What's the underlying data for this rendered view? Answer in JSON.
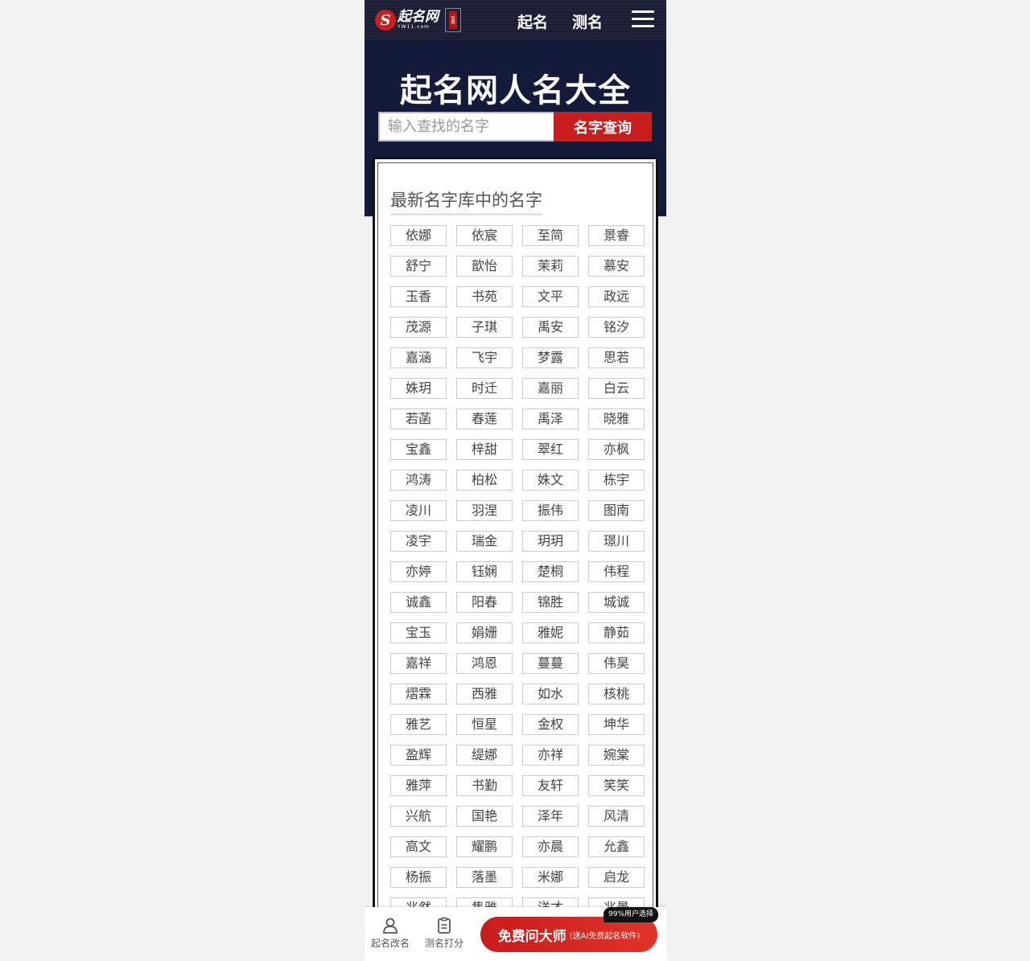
{
  "header": {
    "logo_text": "起名网",
    "logo_sub": "YW11.com",
    "official_badge": "官网",
    "nav": [
      "起名",
      "测名"
    ],
    "menu_icon": "hamburger-menu-icon"
  },
  "hero": {
    "title": "起名网人名大全",
    "search": {
      "placeholder": "输入查找的名字",
      "value": "",
      "button_label": "名字查询"
    }
  },
  "section": {
    "title": "最新名字库中的名字",
    "names": [
      "依娜",
      "依宸",
      "至简",
      "景睿",
      "舒宁",
      "歆怡",
      "茉莉",
      "慕安",
      "玉香",
      "书苑",
      "文平",
      "政远",
      "茂源",
      "子琪",
      "禹安",
      "铭汐",
      "嘉涵",
      "飞宇",
      "梦露",
      "思若",
      "姝玥",
      "时迁",
      "嘉丽",
      "白云",
      "若菡",
      "春莲",
      "禹泽",
      "晓雅",
      "宝鑫",
      "梓甜",
      "翠红",
      "亦枫",
      "鸿涛",
      "柏松",
      "姝文",
      "栋宇",
      "凌川",
      "羽涅",
      "振伟",
      "图南",
      "凌宇",
      "瑞金",
      "玥玥",
      "璟川",
      "亦婷",
      "钰娴",
      "楚桐",
      "伟程",
      "诚鑫",
      "阳春",
      "锦胜",
      "城诚",
      "宝玉",
      "娟姗",
      "雅妮",
      "静茹",
      "嘉祥",
      "鸿恩",
      "蔓蔓",
      "伟昊",
      "熠霖",
      "西雅",
      "如水",
      "核桃",
      "雅艺",
      "恒星",
      "金权",
      "坤华",
      "盈辉",
      "缇娜",
      "亦祥",
      "婉棠",
      "雅萍",
      "书勤",
      "友轩",
      "笑笑",
      "兴航",
      "国艳",
      "泽年",
      "风清",
      "高文",
      "耀鹏",
      "亦晨",
      "允鑫",
      "杨振",
      "落墨",
      "米娜",
      "启龙",
      "兆然",
      "隽雅",
      "洋才",
      "兆景"
    ]
  },
  "bottom_bar": {
    "item1": "起名改名",
    "item2": "测名打分",
    "ask_main": "免费问大师",
    "ask_sub": "(送AI免费起名软件)",
    "badge": "99%用户选择"
  }
}
